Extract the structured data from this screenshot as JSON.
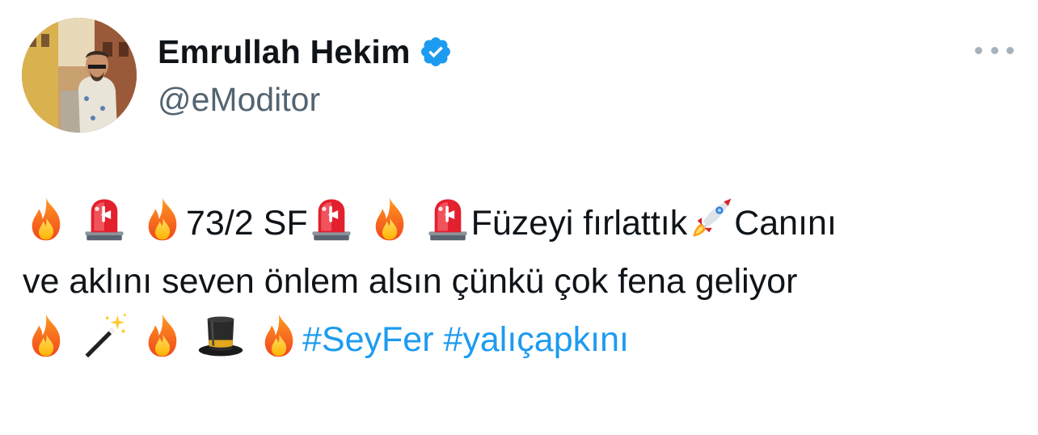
{
  "author": {
    "display_name": "Emrullah Hekim",
    "handle": "@eModitor",
    "verified": true,
    "verified_color": "#1d9bf0"
  },
  "tweet": {
    "text_1": "73/2 SF",
    "text_2": "Füzeyi fırlattık",
    "text_3": "Canını",
    "line_2": "ve aklını seven önlem alsın çünkü çok fena geliyor",
    "hashtag_1": "#SeyFer",
    "hashtag_2": "#yalıçapkını",
    "hashtag_color": "#1d9bf0"
  },
  "icons": {
    "more": "more-options-icon",
    "fire": "fire-emoji",
    "siren": "police-light-emoji",
    "rocket": "rocket-emoji",
    "wand": "magic-wand-emoji",
    "hat": "top-hat-emoji"
  }
}
